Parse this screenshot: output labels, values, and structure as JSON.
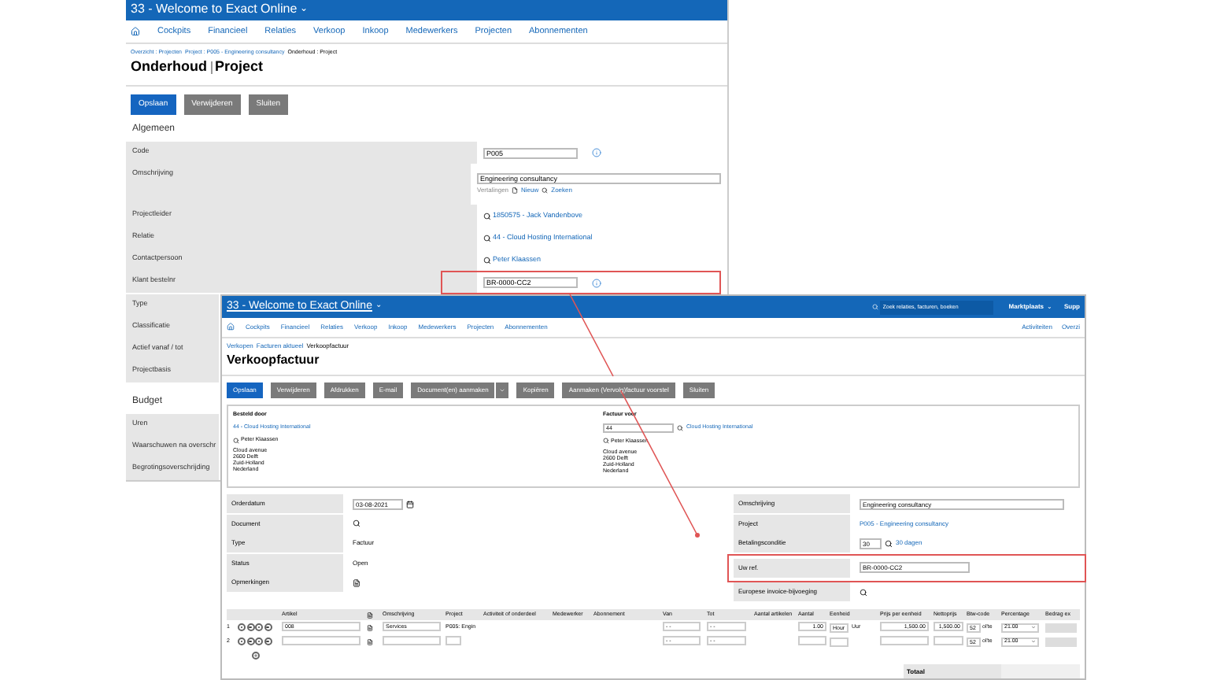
{
  "back_window": {
    "title": "33 - Welcome to Exact Online",
    "title_caret": "⌄",
    "nav": [
      "Cockpits",
      "Financieel",
      "Relaties",
      "Verkoop",
      "Inkoop",
      "Medewerkers",
      "Projecten",
      "Abonnementen"
    ],
    "breadcrumb": [
      "Overzicht : Projecten",
      "Project : P005 - Engineering consultancy",
      "Onderhoud : Project"
    ],
    "page_title": [
      "Onderhoud",
      "Project"
    ],
    "buttons": [
      {
        "label": "Opslaan",
        "kind": "primary"
      },
      {
        "label": "Verwijderen",
        "kind": "secondary"
      },
      {
        "label": "Sluiten",
        "kind": "secondary"
      }
    ],
    "sections": [
      {
        "title": "Algemeen",
        "fields": [
          {
            "label": "Code",
            "kind": "input",
            "value": "P005",
            "info": true
          },
          {
            "label": "Omschrijving",
            "kind": "input",
            "value": "Engineering consultancy",
            "info": false,
            "sub": {
              "label": "Vertalingen",
              "links": [
                "Nieuw",
                "Zoeken"
              ]
            }
          },
          {
            "label": "Projectleider",
            "kind": "link",
            "value": "1850575 - Jack Vandenbove"
          },
          {
            "label": "Relatie",
            "kind": "link",
            "value": "44 - Cloud Hosting International"
          },
          {
            "label": "Contactpersoon",
            "kind": "link",
            "value": "Peter Klaassen"
          },
          {
            "label": "Klant bestelnr",
            "kind": "input",
            "value": "BR-0000-CC2",
            "info": true,
            "highlighted": true
          },
          {
            "label": "Type",
            "kind": "empty"
          },
          {
            "label": "Classificatie",
            "kind": "empty"
          },
          {
            "label": "Actief vanaf / tot",
            "kind": "empty"
          },
          {
            "label": "Projectbasis",
            "kind": "empty"
          }
        ]
      },
      {
        "title": "Budget",
        "fields": [
          {
            "label": "Uren",
            "kind": "empty"
          },
          {
            "label": "Waarschuwen na overschr",
            "kind": "empty"
          },
          {
            "label": "Begrotingsoverschrijding",
            "kind": "empty"
          }
        ]
      }
    ]
  },
  "front_window": {
    "title": "33 - Welcome to Exact Online",
    "title_caret": "⌄",
    "search_placeholder": "Zoek relaties, facturen, boeken",
    "menu": "Marktplaats",
    "menu_caret": "⌄",
    "menu_cut": "Supp",
    "nav": [
      "Cockpits",
      "Financieel",
      "Relaties",
      "Verkoop",
      "Inkoop",
      "Medewerkers",
      "Projecten",
      "Abonnementen"
    ],
    "nav_right": [
      "Activiteiten",
      "Overzi"
    ],
    "breadcrumb": [
      "Verkopen",
      "Facturen aktueel",
      "Verkoopfactuur"
    ],
    "page_title": "Verkoopfactuur",
    "buttons": [
      {
        "label": "Opslaan",
        "kind": "primary"
      },
      {
        "label": "Verwijderen",
        "kind": "secondary"
      },
      {
        "label": "Afdrukken",
        "kind": "secondary"
      },
      {
        "label": "E-mail",
        "kind": "secondary"
      },
      {
        "label": "Document(en) aanmaken",
        "kind": "split"
      },
      {
        "label": "Kopiëren",
        "kind": "secondary"
      },
      {
        "label": "Aanmaken (Vervolg)factuur voorstel",
        "kind": "secondary"
      },
      {
        "label": "Sluiten",
        "kind": "secondary"
      }
    ],
    "parties": [
      {
        "heading": "Besteld door",
        "name": "44 - Cloud Hosting International",
        "contact": "Peter Klaassen",
        "address": [
          "Cloud avenue",
          "2600 Delft",
          "Zuid-Holland",
          "Nederland"
        ]
      },
      {
        "heading": "Factuur voor",
        "number": "44",
        "name": "Cloud Hosting International",
        "contact": "Peter Klaassen",
        "address": [
          "Cloud avenue",
          "2600 Delft",
          "Zuid-Holland",
          "Nederland"
        ]
      }
    ],
    "fields_left": [
      {
        "label": "Orderdatum",
        "kind": "date",
        "value": "03-08-2021"
      },
      {
        "label": "Document",
        "kind": "search"
      },
      {
        "label": "Type",
        "kind": "text",
        "value": "Factuur"
      },
      {
        "label": "Status",
        "kind": "text",
        "value": "Open"
      },
      {
        "label": "Opmerkingen",
        "kind": "note"
      }
    ],
    "fields_right": [
      {
        "label": "Omschrijving",
        "kind": "input",
        "value": "Engineering consultancy"
      },
      {
        "label": "Project",
        "kind": "link",
        "value": "P005 - Engineering consultancy"
      },
      {
        "label": "Betalingsconditie",
        "kind": "code_link",
        "code": "30",
        "value": "30 dagen"
      },
      {
        "label": "Uw ref.",
        "kind": "input",
        "value": "BR-0000-CC2",
        "highlighted": true
      },
      {
        "label": "Europese invoice-bijvoeging",
        "kind": "search"
      }
    ],
    "table": {
      "columns": [
        "",
        "",
        "Artikel",
        "",
        "Omschrijving",
        "Project",
        "Activiteit of onderdeel",
        "Medewerker",
        "Abonnement",
        "Van",
        "Tot",
        "Aantal artikelen",
        "Aantal",
        "Eenheid",
        "Prijs per eenheid",
        "Nettoprijs",
        "Btw-code",
        "Percentage",
        "Bedrag ex"
      ],
      "rows": [
        {
          "number": "1",
          "article": "008",
          "description": "Services",
          "project": "P005: Engin",
          "from": "- -",
          "to": "- -",
          "quantity": "1.00",
          "unit": "Hour",
          "unit_text": "Uur",
          "price": "1,500.00",
          "net": "1,500.00",
          "vat_code": "52",
          "vat_unit": "ol'te",
          "percentage": "21.00"
        },
        {
          "number": "2",
          "article": "",
          "description": "",
          "project": "",
          "from": "- -",
          "to": "- -",
          "quantity": "",
          "unit": "",
          "unit_text": "",
          "price": "",
          "net": "",
          "vat_code": "52",
          "vat_unit": "ol'te",
          "percentage": "21.00"
        }
      ],
      "total_label": "Totaal"
    }
  }
}
